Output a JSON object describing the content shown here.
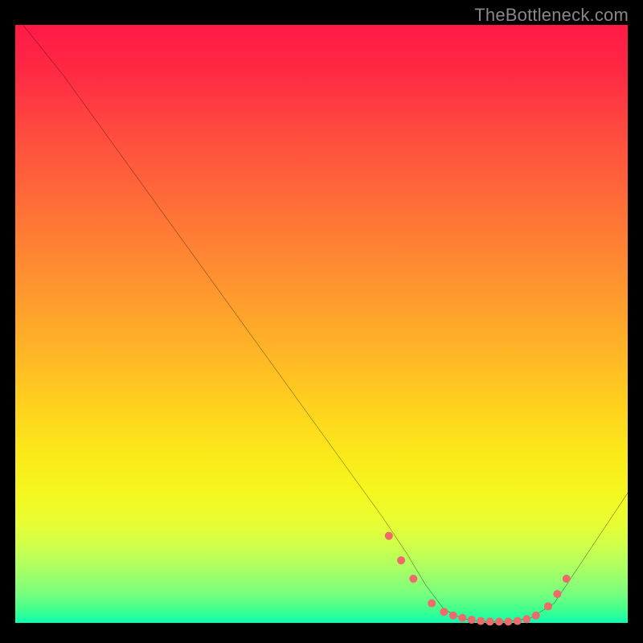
{
  "watermark": "TheBottleneck.com",
  "chart_data": {
    "type": "line",
    "title": "",
    "xlabel": "",
    "ylabel": "",
    "xlim": [
      0,
      100
    ],
    "ylim": [
      0,
      100
    ],
    "grid": false,
    "legend": false,
    "series": [
      {
        "name": "bottleneck-curve",
        "x": [
          0,
          8,
          60,
          64,
          67,
          70,
          73,
          76,
          80,
          84,
          88,
          92,
          100
        ],
        "y": [
          100,
          90,
          18,
          12,
          7,
          3,
          1.5,
          1,
          1,
          1.5,
          4,
          10,
          22
        ],
        "color": "#000000"
      }
    ],
    "markers": {
      "name": "sweet-spot-markers",
      "color": "#ef6a6a",
      "radius": 5,
      "points": [
        {
          "x": 61,
          "y": 15
        },
        {
          "x": 63,
          "y": 11
        },
        {
          "x": 65,
          "y": 8
        },
        {
          "x": 68,
          "y": 4
        },
        {
          "x": 70,
          "y": 2.6
        },
        {
          "x": 71.5,
          "y": 2
        },
        {
          "x": 73,
          "y": 1.6
        },
        {
          "x": 74.5,
          "y": 1.3
        },
        {
          "x": 76,
          "y": 1.1
        },
        {
          "x": 77.5,
          "y": 1
        },
        {
          "x": 79,
          "y": 1
        },
        {
          "x": 80.5,
          "y": 1
        },
        {
          "x": 82,
          "y": 1.1
        },
        {
          "x": 83.5,
          "y": 1.4
        },
        {
          "x": 85,
          "y": 2
        },
        {
          "x": 87,
          "y": 3.5
        },
        {
          "x": 88.5,
          "y": 5.5
        },
        {
          "x": 90,
          "y": 8
        }
      ]
    },
    "gradient": {
      "orientation": "vertical",
      "stops": [
        {
          "offset": 0,
          "color": "#ff1a46"
        },
        {
          "offset": 50,
          "color": "#ffc020"
        },
        {
          "offset": 80,
          "color": "#f4f71f"
        },
        {
          "offset": 100,
          "color": "#0cffb4"
        }
      ]
    }
  }
}
